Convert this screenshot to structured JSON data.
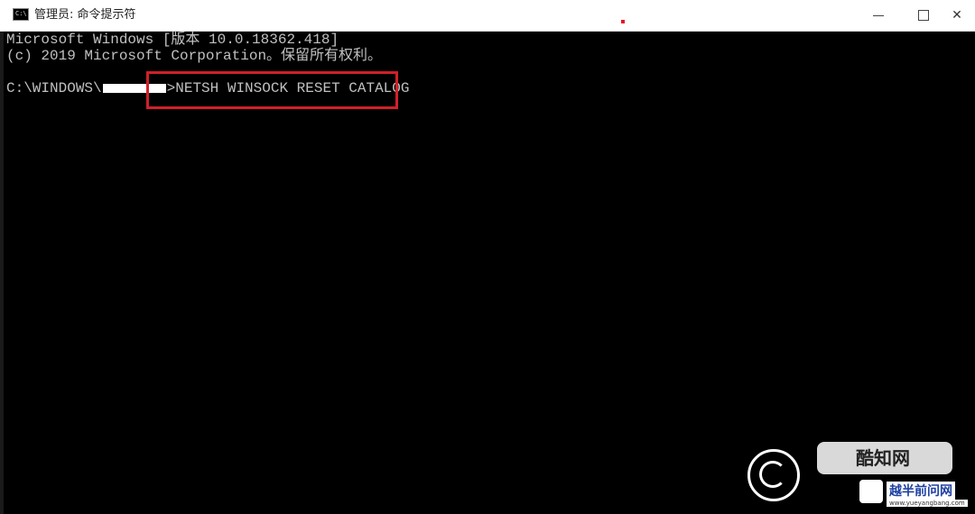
{
  "window": {
    "title": "管理员: 命令提示符",
    "icon": "cmd-icon",
    "icon_text": "C:\\"
  },
  "console": {
    "line1": "Microsoft Windows [版本 10.0.18362.418]",
    "line2": "(c) 2019 Microsoft Corporation。保留所有权利。",
    "prompt_path": "C:\\WINDOWS\\",
    "prompt_symbol": ">",
    "command": "NETSH WINSOCK RESET CATALOG"
  },
  "watermark": {
    "text1": "酷知网",
    "text2": "越半前问网",
    "url": "www.yueyangbang.com"
  },
  "colors": {
    "console_bg": "#000000",
    "console_text": "#c0c0c0",
    "highlight_border": "#d0202a"
  }
}
